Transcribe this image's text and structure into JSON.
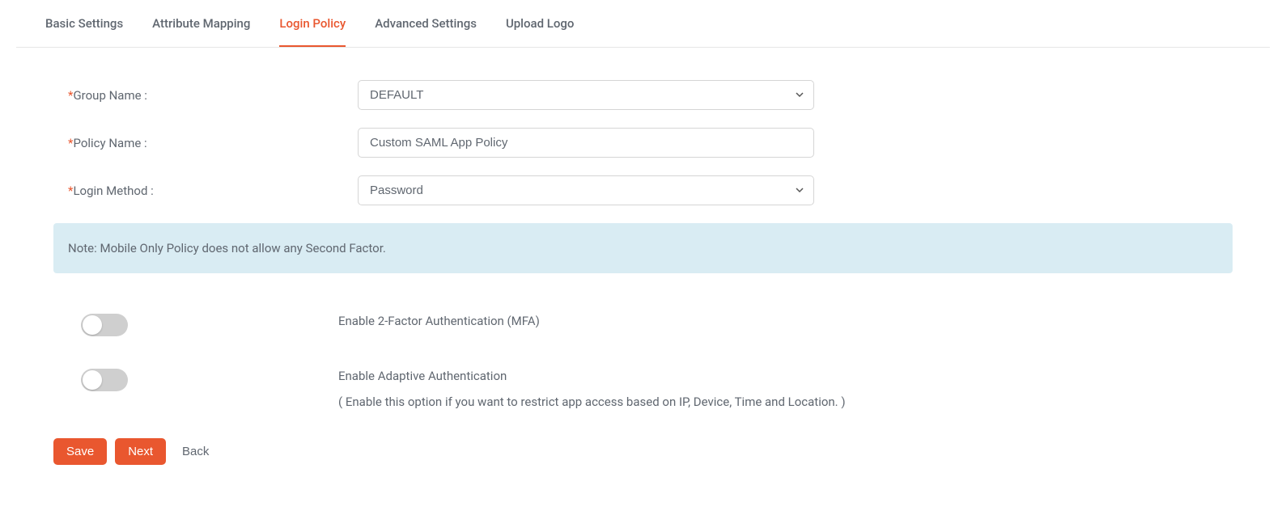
{
  "tabs": {
    "basic": "Basic Settings",
    "attribute": "Attribute Mapping",
    "login": "Login Policy",
    "advanced": "Advanced Settings",
    "upload": "Upload Logo",
    "active": "login"
  },
  "form": {
    "groupName": {
      "label": "Group Name :",
      "value": "DEFAULT"
    },
    "policyName": {
      "label": "Policy Name :",
      "value": "Custom SAML App Policy"
    },
    "loginMethod": {
      "label": "Login Method :",
      "value": "Password"
    }
  },
  "note": "Note: Mobile Only Policy does not allow any Second Factor.",
  "toggles": {
    "mfa": {
      "label": "Enable 2-Factor Authentication (MFA)",
      "on": false
    },
    "adaptive": {
      "label": "Enable Adaptive Authentication",
      "hint": "( Enable this option if you want to restrict app access based on IP, Device, Time and Location. )",
      "on": false
    }
  },
  "buttons": {
    "save": "Save",
    "next": "Next",
    "back": "Back"
  }
}
